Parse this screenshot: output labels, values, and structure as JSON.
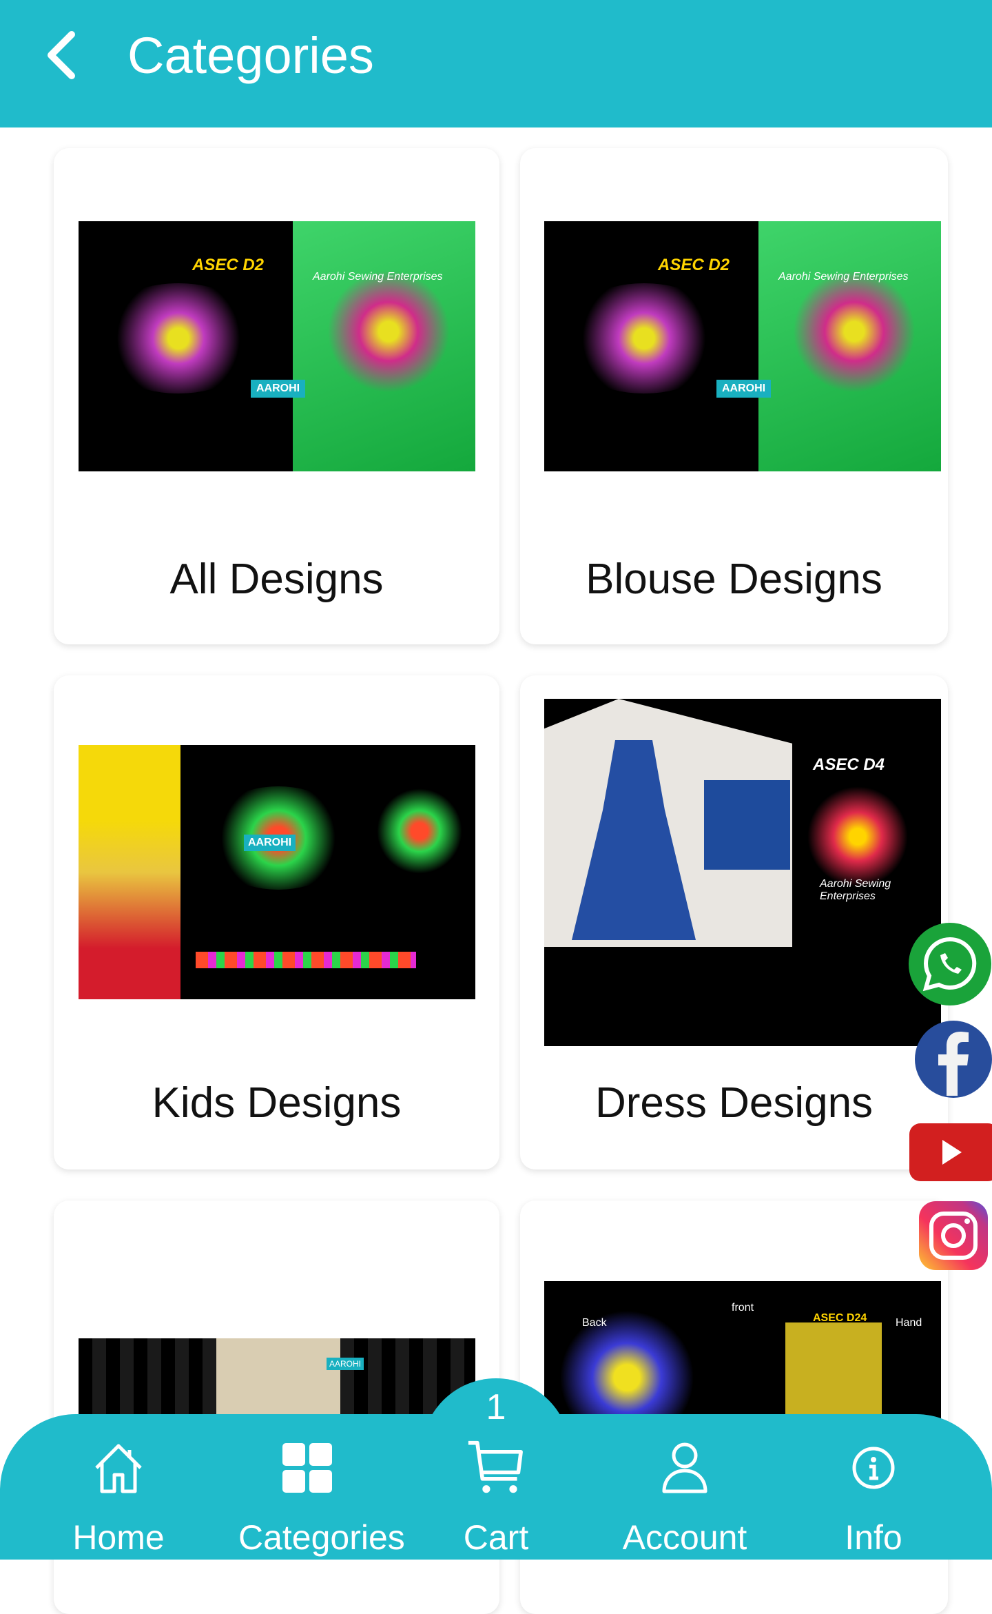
{
  "header": {
    "title": "Categories",
    "back_icon": "chevron-left-icon"
  },
  "categories": [
    {
      "label": "All Designs",
      "image_text": [
        "ASEC D2",
        "Aarohi Sewing Enterprises",
        "AAROHI"
      ]
    },
    {
      "label": "Blouse Designs",
      "image_text": [
        "ASEC D2",
        "Aarohi Sewing Enterprises",
        "AAROHI"
      ]
    },
    {
      "label": "Kids Designs",
      "image_text": [
        "AAROHI"
      ]
    },
    {
      "label": "Dress Designs",
      "image_text": [
        "ASEC D4",
        "Aarohi Sewing Enterprises"
      ]
    },
    {
      "label": "",
      "image_text": [
        "AAROHI"
      ]
    },
    {
      "label": "",
      "image_text": [
        "Back",
        "front",
        "ASEC D24",
        "Hand"
      ]
    }
  ],
  "social": [
    {
      "name": "whatsapp",
      "color": "#1aa33a"
    },
    {
      "name": "facebook",
      "color": "#284d9c"
    },
    {
      "name": "youtube",
      "color": "#d21f1f"
    },
    {
      "name": "instagram",
      "color": "#e1306c"
    }
  ],
  "bottom_nav": {
    "cart_count": "1",
    "items": [
      {
        "label": "Home",
        "icon": "home-icon"
      },
      {
        "label": "Categories",
        "icon": "grid-icon"
      },
      {
        "label": "Cart",
        "icon": "cart-icon"
      },
      {
        "label": "Account",
        "icon": "user-icon"
      },
      {
        "label": "Info",
        "icon": "info-icon"
      }
    ]
  },
  "colors": {
    "primary": "#20bbcb"
  }
}
